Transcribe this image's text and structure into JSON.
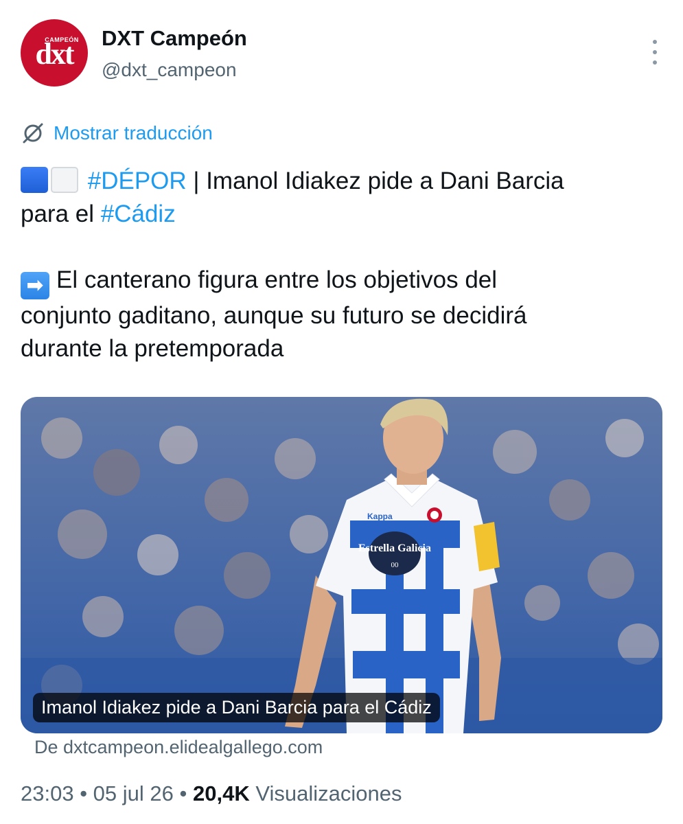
{
  "author": {
    "avatar_small": "CAMPEÓN",
    "avatar_main": "dxt",
    "display_name": "DXT Campeón",
    "handle": "@dxt_campeon"
  },
  "translate": {
    "label": "Mostrar traducción",
    "icon": "globe-slash-icon"
  },
  "tweet": {
    "line1": {
      "emoji": [
        "blue-square",
        "white-square"
      ],
      "hashtag": "#DÉPOR",
      "text": " | Imanol Idiakez pide a Dani Barcia"
    },
    "line2": {
      "text": "para el ",
      "hashtag": "#Cádiz"
    },
    "paragraph2": {
      "emoji": "right-arrow",
      "arrow_glyph": "➡",
      "line1": "El canterano figura entre los objetivos del",
      "line2": "conjunto gaditano, aunque su futuro se decidirá",
      "line3": "durante la pretemporada"
    }
  },
  "card": {
    "caption": "Imanol Idiakez pide a Dani Barcia para el Cádiz",
    "source": "De dxtcampeon.elidealgallego.com",
    "jersey_sponsor": "Estrella Galicia",
    "jersey_sponsor_sub": "00",
    "jersey_brand": "Kappa"
  },
  "meta": {
    "time": "23:03",
    "separator": " • ",
    "date": "05 jul 26",
    "views_count": "20,4K",
    "views_label": " Visualizaciones"
  },
  "colors": {
    "link": "#1d9bf0",
    "secondary_text": "#536471",
    "brand_red": "#c8102e"
  }
}
